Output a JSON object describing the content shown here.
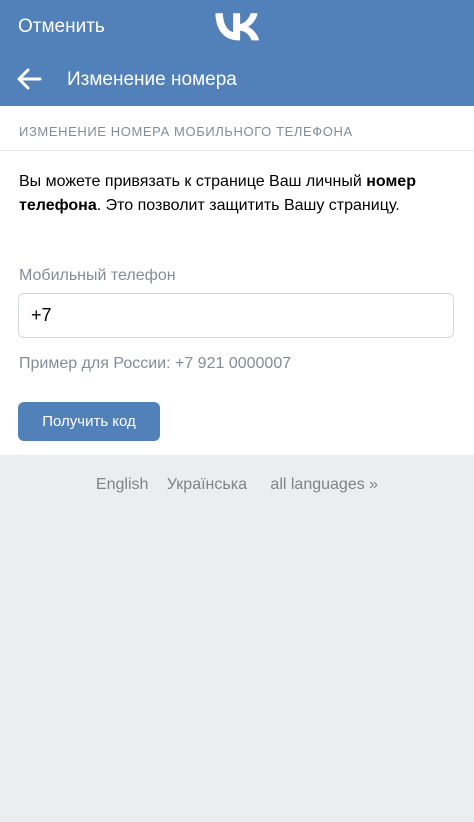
{
  "header": {
    "cancel_label": "Отменить",
    "logo": "vk-logo",
    "brand_color": "#5181b8"
  },
  "subheader": {
    "back_icon": "arrow-left-icon",
    "title": "Изменение номера"
  },
  "main": {
    "section_title": "ИЗМЕНЕНИЕ НОМЕРА МОБИЛЬНОГО ТЕЛЕФОНА",
    "description_part1": "Вы можете привязать к странице Ваш личный ",
    "description_bold": "номер телефона",
    "description_part2": ". Это позволит защитить Вашу страницу.",
    "phone_label": "Мобильный телефон",
    "phone_value": "+7",
    "hint": "Пример для России: +7 921 0000007",
    "submit_label": "Получить код"
  },
  "footer": {
    "languages": [
      "English",
      "Українська",
      "all languages »"
    ]
  }
}
